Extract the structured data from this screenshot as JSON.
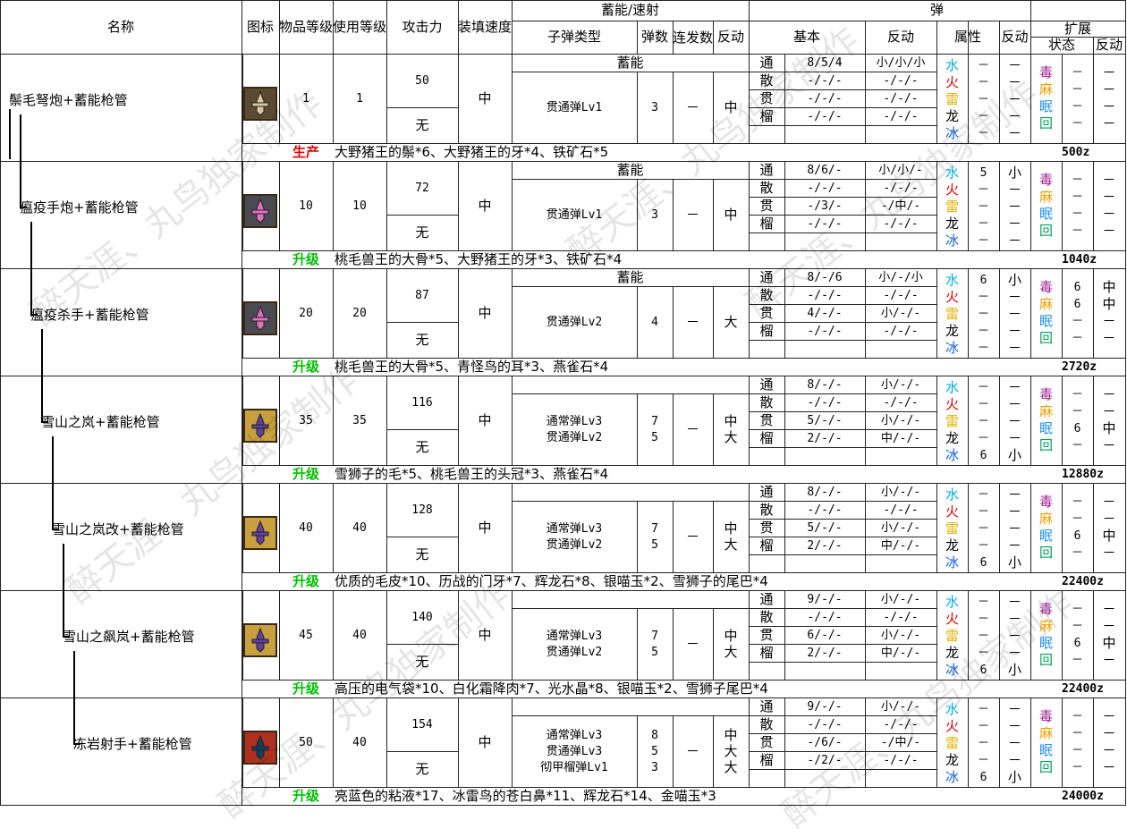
{
  "header": {
    "name": "名称",
    "icon": "图标",
    "item_level": "物品等级",
    "use_level": "使用等级",
    "attack": "攻击力",
    "reload": "装填速度",
    "charge_group": "蓄能/速射",
    "bullet_type": "子弹类型",
    "bullet_count": "弹数",
    "burst": "连发数",
    "recoil": "反动",
    "shot_group": "弹",
    "basic": "基本",
    "shot_recoil": "反动",
    "attribute": "属性",
    "attr_recoil": "反动",
    "ext_group": "扩展",
    "status": "状态",
    "ext_recoil": "反动"
  },
  "shot_labels": [
    "通",
    "散",
    "贯",
    "榴"
  ],
  "elements": [
    "水",
    "火",
    "雷",
    "龙",
    "冰"
  ],
  "statuses": [
    "毒",
    "麻",
    "眠",
    "回"
  ],
  "colors": {
    "water": "#00b0e0",
    "fire": "#e00000",
    "thunder": "#e0b000",
    "dragon": "#000000",
    "ice": "#1060e0",
    "poison": "#a02090",
    "paralysis": "#f0a000",
    "sleep": "#2090f0",
    "heal": "#00a060",
    "produce": "#e00000",
    "upgrade": "#00c000"
  },
  "weapons": [
    {
      "name": "鬃毛弩炮+蓄能枪管",
      "item_level": "1",
      "use_level": "1",
      "attack": "50",
      "defense": "无",
      "reload": "中",
      "mode": "蓄能",
      "bullets": [
        "贯通弹Lv1"
      ],
      "counts": [
        "3"
      ],
      "burst": "－",
      "recoil": [
        "中"
      ],
      "basic": [
        "8/5/4",
        "-/-/-",
        "-/-/-",
        "-/-/-"
      ],
      "shot_recoil": [
        "小/小/小",
        "-/-/-",
        "-/-/-",
        "-/-/-"
      ],
      "attr_vals": [
        "－",
        "－",
        "－",
        "－",
        "－"
      ],
      "attr_recoil": [
        "－",
        "－",
        "－",
        "－",
        "－"
      ],
      "status_vals": [
        "－",
        "－",
        "－",
        "－"
      ],
      "status_recoil": [
        "－",
        "－",
        "－",
        "－"
      ],
      "action": "生产",
      "action_color": "produce",
      "materials": "大野猪王的鬃*6、大野猪王的牙*4、铁矿石*5",
      "price": "500z",
      "icon_bg": "#5a4a32",
      "icon_fg": "#d8c8a0"
    },
    {
      "name": "瘟疫手炮+蓄能枪管",
      "item_level": "10",
      "use_level": "10",
      "attack": "72",
      "defense": "无",
      "reload": "中",
      "mode": "蓄能",
      "bullets": [
        "贯通弹Lv1"
      ],
      "counts": [
        "3"
      ],
      "burst": "－",
      "recoil": [
        "中"
      ],
      "basic": [
        "8/6/-",
        "-/-/-",
        "-/3/-",
        "-/-/-"
      ],
      "shot_recoil": [
        "小/小/-",
        "-/-/-",
        "-/中/-",
        "-/-/-"
      ],
      "attr_vals": [
        "5",
        "－",
        "－",
        "－",
        "－"
      ],
      "attr_recoil": [
        "小",
        "－",
        "－",
        "－",
        "－"
      ],
      "status_vals": [
        "－",
        "－",
        "－",
        "－"
      ],
      "status_recoil": [
        "－",
        "－",
        "－",
        "－"
      ],
      "action": "升级",
      "action_color": "upgrade",
      "materials": "桃毛兽王的大骨*5、大野猪王的牙*3、铁矿石*4",
      "price": "1040z",
      "icon_bg": "#4a4a52",
      "icon_fg": "#e070c0"
    },
    {
      "name": "瘟疫杀手+蓄能枪管",
      "item_level": "20",
      "use_level": "20",
      "attack": "87",
      "defense": "无",
      "reload": "中",
      "mode": "蓄能",
      "bullets": [
        "贯通弹Lv2"
      ],
      "counts": [
        "4"
      ],
      "burst": "－",
      "recoil": [
        "大"
      ],
      "basic": [
        "8/-/6",
        "-/-/-",
        "4/-/-",
        "-/-/-"
      ],
      "shot_recoil": [
        "小/-/小",
        "-/-/-",
        "小/-/-",
        "-/-/-"
      ],
      "attr_vals": [
        "6",
        "－",
        "－",
        "－",
        "－"
      ],
      "attr_recoil": [
        "小",
        "－",
        "－",
        "－",
        "－"
      ],
      "status_vals": [
        "6",
        "6",
        "－",
        "－"
      ],
      "status_recoil": [
        "中",
        "中",
        "－",
        "－"
      ],
      "action": "升级",
      "action_color": "upgrade",
      "materials": "桃毛兽王的大骨*5、青怪鸟的耳*3、燕雀石*4",
      "price": "2720z",
      "icon_bg": "#4a4a52",
      "icon_fg": "#e070c0"
    },
    {
      "name": "雪山之岚+蓄能枪管",
      "item_level": "35",
      "use_level": "35",
      "attack": "116",
      "defense": "无",
      "reload": "中",
      "mode": "",
      "bullets": [
        "通常弹Lv3",
        "贯通弹Lv2"
      ],
      "counts": [
        "7",
        "5"
      ],
      "burst": "－",
      "recoil": [
        "中",
        "大"
      ],
      "basic": [
        "8/-/-",
        "-/-/-",
        "5/-/-",
        "2/-/-"
      ],
      "shot_recoil": [
        "小/-/-",
        "-/-/-",
        "小/-/-",
        "中/-/-"
      ],
      "attr_vals": [
        "－",
        "－",
        "－",
        "－",
        "6"
      ],
      "attr_recoil": [
        "－",
        "－",
        "－",
        "－",
        "小"
      ],
      "status_vals": [
        "－",
        "－",
        "6",
        "－"
      ],
      "status_recoil": [
        "－",
        "－",
        "中",
        "－"
      ],
      "action": "升级",
      "action_color": "upgrade",
      "materials": "雪狮子的毛*5、桃毛兽王的头冠*3、燕雀石*4",
      "price": "12880z",
      "icon_bg": "#c8a040",
      "icon_fg": "#6040a0"
    },
    {
      "name": "雪山之岚改+蓄能枪管",
      "item_level": "40",
      "use_level": "40",
      "attack": "128",
      "defense": "无",
      "reload": "中",
      "mode": "",
      "bullets": [
        "通常弹Lv3",
        "贯通弹Lv2"
      ],
      "counts": [
        "7",
        "5"
      ],
      "burst": "－",
      "recoil": [
        "中",
        "大"
      ],
      "basic": [
        "8/-/-",
        "-/-/-",
        "5/-/-",
        "2/-/-"
      ],
      "shot_recoil": [
        "小/-/-",
        "-/-/-",
        "小/-/-",
        "中/-/-"
      ],
      "attr_vals": [
        "－",
        "－",
        "－",
        "－",
        "6"
      ],
      "attr_recoil": [
        "－",
        "－",
        "－",
        "－",
        "小"
      ],
      "status_vals": [
        "－",
        "－",
        "6",
        "－"
      ],
      "status_recoil": [
        "－",
        "－",
        "中",
        "－"
      ],
      "action": "升级",
      "action_color": "upgrade",
      "materials": "优质的毛皮*10、历战的门牙*7、辉龙石*8、银喵玉*2、雪狮子的尾巴*4",
      "price": "22400z",
      "icon_bg": "#c8a040",
      "icon_fg": "#6040a0"
    },
    {
      "name": "雪山之飙岚+蓄能枪管",
      "item_level": "45",
      "use_level": "40",
      "attack": "140",
      "defense": "无",
      "reload": "中",
      "mode": "",
      "bullets": [
        "通常弹Lv3",
        "贯通弹Lv2"
      ],
      "counts": [
        "7",
        "5"
      ],
      "burst": "－",
      "recoil": [
        "中",
        "大"
      ],
      "basic": [
        "9/-/-",
        "-/-/-",
        "6/-/-",
        "2/-/-"
      ],
      "shot_recoil": [
        "小/-/-",
        "-/-/-",
        "小/-/-",
        "中/-/-"
      ],
      "attr_vals": [
        "－",
        "－",
        "－",
        "－",
        "6"
      ],
      "attr_recoil": [
        "－",
        "－",
        "－",
        "－",
        "小"
      ],
      "status_vals": [
        "－",
        "－",
        "6",
        "－"
      ],
      "status_recoil": [
        "－",
        "－",
        "中",
        "－"
      ],
      "action": "升级",
      "action_color": "upgrade",
      "materials": "高压的电气袋*10、白化霜降肉*7、光水晶*8、银喵玉*2、雪狮子尾巴*4",
      "price": "22400z",
      "icon_bg": "#c8a040",
      "icon_fg": "#6040a0"
    },
    {
      "name": "冻岩射手+蓄能枪管",
      "item_level": "50",
      "use_level": "40",
      "attack": "154",
      "defense": "无",
      "reload": "中",
      "mode": "",
      "bullets": [
        "通常弹Lv3",
        "贯通弹Lv3",
        "彻甲榴弹Lv1"
      ],
      "counts": [
        "8",
        "5",
        "3"
      ],
      "burst": "－",
      "recoil": [
        "中",
        "大",
        "大"
      ],
      "basic": [
        "9/-/-",
        "-/-/-",
        "-/6/-",
        "-/2/-"
      ],
      "shot_recoil": [
        "小/-/-",
        "-/-/-",
        "-/中/-",
        "-/-/-"
      ],
      "attr_vals": [
        "－",
        "－",
        "－",
        "－",
        "6"
      ],
      "attr_recoil": [
        "－",
        "－",
        "－",
        "－",
        "小"
      ],
      "status_vals": [
        "－",
        "－",
        "－",
        "－"
      ],
      "status_recoil": [
        "－",
        "－",
        "－",
        "－"
      ],
      "action": "升级",
      "action_color": "upgrade",
      "materials": "亮蓝色的粘液*17、冰雷鸟的苍白鼻*11、辉龙石*14、金喵玉*3",
      "price": "24000z",
      "icon_bg": "#b03020",
      "icon_fg": "#104060"
    }
  ],
  "watermark": "醉天涯、丸鸟独家制作"
}
